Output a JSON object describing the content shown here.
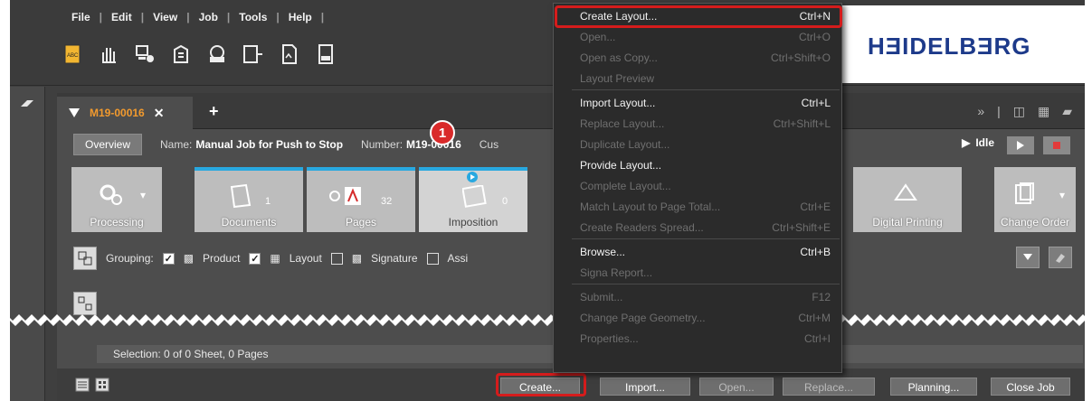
{
  "menubar": {
    "items": [
      "File",
      "Edit",
      "View",
      "Job",
      "Tools",
      "Help"
    ]
  },
  "toolbar_icons": [
    "abc-doc-icon",
    "hand-icon",
    "computer-gear-icon",
    "building-icon",
    "globe-printer-icon",
    "abc-arrow-icon",
    "signed-doc-icon",
    "doc-doc-icon"
  ],
  "brand": {
    "logo": "HƎIDELBƎRG"
  },
  "tab": {
    "name": "M19-00016",
    "close": "✕",
    "plus": "+"
  },
  "info": {
    "overview": "Overview",
    "name_label": "Name:",
    "name_value": "Manual Job for Push to Stop",
    "number_label": "Number:",
    "number_value": "M19-00016",
    "customer_label": "Cus",
    "status": "Idle"
  },
  "steps": {
    "processing": "Processing",
    "documents": "Documents",
    "documents_count": "1",
    "pages": "Pages",
    "pages_count": "32",
    "imposition": "Imposition",
    "imposition_count": "0",
    "digital_printing": "Digital Printing",
    "change_order": "Change Order",
    "badge": "1"
  },
  "grouping": {
    "label": "Grouping:",
    "product": "Product",
    "layout": "Layout",
    "signature": "Signature",
    "assign": "Assi"
  },
  "selection": "Selection:  0 of 0 Sheet,  0 Pages",
  "bottom_buttons": {
    "create": "Create...",
    "import": "Import...",
    "open": "Open...",
    "replace": "Replace...",
    "planning": "Planning...",
    "close_job": "Close Job"
  },
  "dropdown": [
    {
      "label": "Create Layout...",
      "shortcut": "Ctrl+N",
      "enabled": true
    },
    {
      "label": "Open...",
      "shortcut": "Ctrl+O",
      "enabled": false
    },
    {
      "label": "Open as Copy...",
      "shortcut": "Ctrl+Shift+O",
      "enabled": false
    },
    {
      "label": "Layout Preview",
      "shortcut": "",
      "enabled": false
    },
    {
      "label": "Import Layout...",
      "shortcut": "Ctrl+L",
      "enabled": true
    },
    {
      "label": "Replace Layout...",
      "shortcut": "Ctrl+Shift+L",
      "enabled": false
    },
    {
      "label": "Duplicate Layout...",
      "shortcut": "",
      "enabled": false
    },
    {
      "label": "Provide Layout...",
      "shortcut": "",
      "enabled": true
    },
    {
      "label": "Complete Layout...",
      "shortcut": "",
      "enabled": false
    },
    {
      "label": "Match Layout to Page Total...",
      "shortcut": "Ctrl+E",
      "enabled": false
    },
    {
      "label": "Create Readers Spread...",
      "shortcut": "Ctrl+Shift+E",
      "enabled": false
    },
    {
      "label": "Browse...",
      "shortcut": "Ctrl+B",
      "enabled": true
    },
    {
      "label": "Signa Report...",
      "shortcut": "",
      "enabled": false
    },
    {
      "label": "Submit...",
      "shortcut": "F12",
      "enabled": false
    },
    {
      "label": "Change Page Geometry...",
      "shortcut": "Ctrl+M",
      "enabled": false
    },
    {
      "label": "Properties...",
      "shortcut": "Ctrl+I",
      "enabled": false
    }
  ],
  "colors": {
    "accent_orange": "#f29a2e",
    "highlight_red": "#d51c1c",
    "progress_blue": "#28a8e0",
    "brand_blue": "#1d3a8a"
  }
}
